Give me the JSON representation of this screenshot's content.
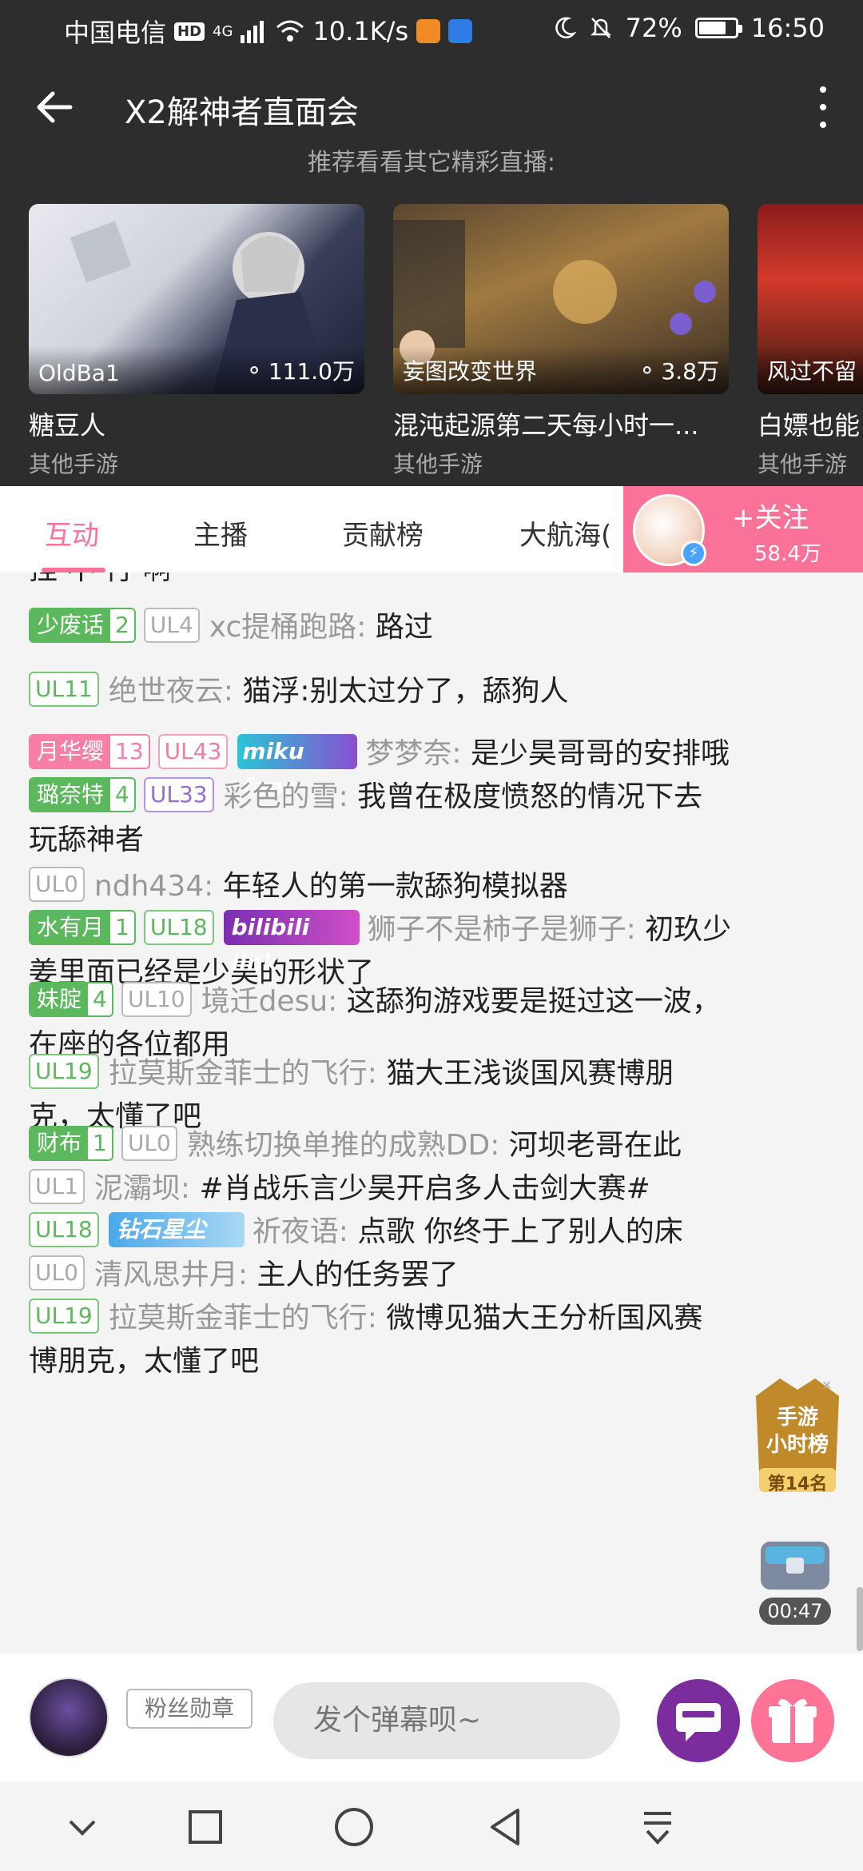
{
  "status": {
    "carrier": "中国电信",
    "hd": "HD",
    "net": "4G",
    "speed": "10.1K/s",
    "battery": "72%",
    "time": "16:50"
  },
  "header": {
    "title": "X2解神者直面会",
    "subtitle": "推荐看看其它精彩直播:"
  },
  "recommend": [
    {
      "host": "OldBa1",
      "views": "111.0万",
      "name": "糖豆人",
      "category": "其他手游"
    },
    {
      "host": "妄图改变世界",
      "views": "3.8万",
      "name": "混沌起源第二天每小时一...",
      "category": "其他手游"
    },
    {
      "host": "风过不留",
      "views": "",
      "name": "白嫖也能",
      "category": "其他手游"
    }
  ],
  "tabs": [
    "互动",
    "主播",
    "贡献榜",
    "大航海("
  ],
  "follow": {
    "label": "+关注",
    "count": "58.4万"
  },
  "chat": {
    "partial_top": "挂 不 行 啊",
    "messages": [
      {
        "medal": "少废话",
        "medal_level": "2",
        "ul": "UL4",
        "user": "xc提桶跑路:",
        "text": "路过"
      },
      {
        "ul": "UL11",
        "user": "绝世夜云:",
        "text": "猫浮:别太过分了，舔狗人"
      },
      {
        "medal": "月华缨",
        "medal_level": "13",
        "ul": "UL43",
        "deco": "miku fans",
        "user": "梦梦奈:",
        "text": "是少昊哥哥的安排哦"
      },
      {
        "medal": "璐奈特",
        "medal_level": "4",
        "ul": "UL33",
        "user": "彩色的雪:",
        "text": "我曾在极度愤怒的情况下去",
        "text2": "玩舔神者"
      },
      {
        "ul": "UL0",
        "user": "ndh434:",
        "text": "年轻人的第一款舔狗模拟器"
      },
      {
        "medal": "水有月",
        "medal_level": "1",
        "ul": "UL18",
        "deco": "bilibili link",
        "user": "狮子不是柿子是狮子:",
        "text": "初玖少",
        "text2": "姜里面已经是少昊的形状了"
      },
      {
        "medal": "妹腚",
        "medal_level": "4",
        "ul": "UL10",
        "user": "境迁desu:",
        "text": "这舔狗游戏要是挺过这一波，",
        "text2": "在座的各位都用"
      },
      {
        "ul": "UL19",
        "user": "拉莫斯金菲士的飞行:",
        "text": "猫大王浅谈国风赛博朋",
        "text2": "克，太懂了吧"
      },
      {
        "medal": "财布",
        "medal_level": "1",
        "ul": "UL0",
        "user": "熟练切换单推的成熟DD:",
        "text": "河坝老哥在此"
      },
      {
        "ul": "UL1",
        "user": "泥灞坝:",
        "text": "#肖战乐言少昊开启多人击剑大赛#"
      },
      {
        "ul": "UL18",
        "deco": "钻石星尘",
        "user": "祈夜语:",
        "text": "点歌 你终于上了别人的床"
      },
      {
        "ul": "UL0",
        "user": "清风思井月:",
        "text": "主人的任务罢了"
      },
      {
        "ul": "UL19",
        "user": "拉莫斯金菲士的飞行:",
        "text": "微博见猫大王分析国风赛",
        "text2": "博朋克，太懂了吧"
      }
    ]
  },
  "rank_badge": {
    "line1": "手游",
    "line2": "小时榜",
    "place": "第14名"
  },
  "chest_timer": "00:47",
  "bottom": {
    "fan_badge": "粉丝勋章",
    "input_placeholder": "发个弹幕呗~"
  },
  "colors": {
    "accent": "#fb7299",
    "dark_header": "#2d2d2d",
    "ul_green": "#5cb85c",
    "medal_green": "#5cb85c",
    "medal_pink": "#f77fa5"
  }
}
